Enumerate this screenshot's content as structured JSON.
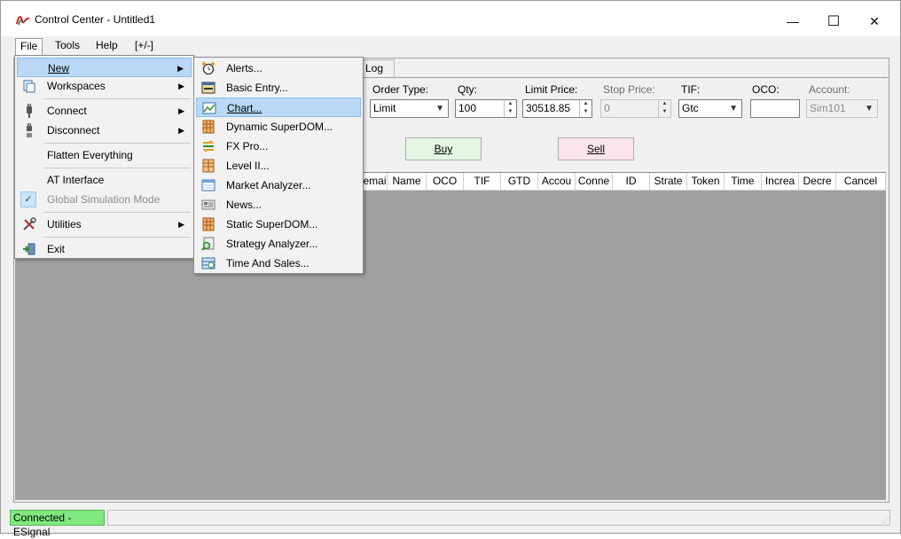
{
  "window": {
    "title": "Control Center - Untitled1",
    "minimize_glyph": "—",
    "maximize_glyph": "☐",
    "close_glyph": "✕"
  },
  "menubar": {
    "file": "File",
    "tools": "Tools",
    "help": "Help",
    "toggle": "[+/-]"
  },
  "file_menu": {
    "items": [
      {
        "label": "New",
        "icon": "new-icon",
        "submenu": true,
        "highlighted": true
      },
      {
        "label": "Workspaces",
        "icon": "workspaces-icon",
        "submenu": true
      },
      {
        "label": "Connect",
        "icon": "plug-connect-icon",
        "submenu": true
      },
      {
        "label": "Disconnect",
        "icon": "plug-disconnect-icon",
        "submenu": true
      },
      {
        "label": "Flatten Everything",
        "icon": ""
      },
      {
        "label": "AT Interface",
        "icon": ""
      },
      {
        "label": "Global Simulation Mode",
        "icon": "checkmark-icon",
        "disabled": true
      },
      {
        "label": "Utilities",
        "icon": "tools-icon",
        "submenu": true
      },
      {
        "label": "Exit",
        "icon": "exit-icon"
      }
    ]
  },
  "new_menu": {
    "items": [
      {
        "label": "Alerts...",
        "icon": "alarm-clock-icon"
      },
      {
        "label": "Basic Entry...",
        "icon": "basic-entry-icon"
      },
      {
        "label": "Chart...",
        "icon": "chart-icon",
        "highlighted": true
      },
      {
        "label": "Dynamic SuperDOM...",
        "icon": "superdom-icon"
      },
      {
        "label": "FX Pro...",
        "icon": "fx-pro-icon"
      },
      {
        "label": "Level II...",
        "icon": "level-two-icon"
      },
      {
        "label": "Market Analyzer...",
        "icon": "market-analyzer-icon"
      },
      {
        "label": "News...",
        "icon": "news-icon"
      },
      {
        "label": "Static SuperDOM...",
        "icon": "static-superdom-icon"
      },
      {
        "label": "Strategy Analyzer...",
        "icon": "strategy-analyzer-icon"
      },
      {
        "label": "Time And Sales...",
        "icon": "time-and-sales-icon"
      }
    ]
  },
  "tab": {
    "log": "Log"
  },
  "order_entry": {
    "order_type_label": "Order Type:",
    "order_type_value": "Limit",
    "qty_label": "Qty:",
    "qty_value": "100",
    "limit_price_label": "Limit Price:",
    "limit_price_value": "30518.85",
    "stop_price_label": "Stop Price:",
    "stop_price_value": "0",
    "tif_label": "TIF:",
    "tif_value": "Gtc",
    "oco_label": "OCO:",
    "oco_value": "",
    "account_label": "Account:",
    "account_value": "Sim101",
    "buy_label": "Buy",
    "sell_label": "Sell"
  },
  "grid": {
    "columns": [
      "emai",
      "Name",
      "OCO",
      "TIF",
      "GTD",
      "Accou",
      "Conne",
      "ID",
      "Strate",
      "Token",
      "Time",
      "Increa",
      "Decre",
      "Cancel"
    ]
  },
  "status": {
    "connection": "Connected - ESignal",
    "connection_color": "#7fe87f"
  }
}
